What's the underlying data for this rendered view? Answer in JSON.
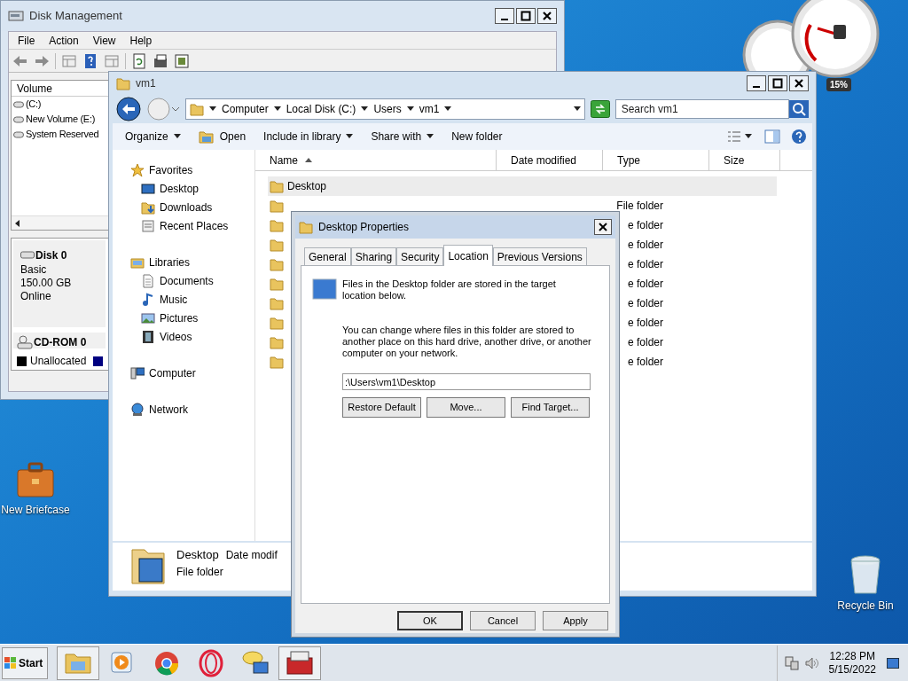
{
  "disk_management": {
    "title": "Disk Management",
    "menu": [
      "File",
      "Action",
      "View",
      "Help"
    ],
    "volume_header": "Volume",
    "volumes": [
      "(C:)",
      "New Volume (E:)",
      "System Reserved"
    ],
    "disks": [
      {
        "kind": "hdd",
        "name": "Disk 0",
        "lines": [
          "Basic",
          "150.00 GB",
          "Online"
        ]
      },
      {
        "kind": "cdrom",
        "name": "CD-ROM 0"
      }
    ],
    "legend": [
      {
        "label": "Unallocated",
        "color": "#000000"
      },
      {
        "color": "#000080"
      }
    ]
  },
  "gadget": {
    "reading": "15%"
  },
  "explorer": {
    "title": "vm1",
    "breadcrumb": [
      "Computer",
      "Local Disk (C:)",
      "Users",
      "vm1"
    ],
    "search": {
      "placeholder": "Search vm1"
    },
    "toolbar": [
      {
        "label": "Organize",
        "kind": "menu"
      },
      {
        "label": "Open",
        "kind": "open"
      },
      {
        "label": "Include in library",
        "kind": "menu"
      },
      {
        "label": "Share with",
        "kind": "menu"
      },
      {
        "label": "New folder",
        "kind": "plain"
      }
    ],
    "nav": [
      {
        "label": "Favorites",
        "kind": "star",
        "children": [
          {
            "label": "Desktop",
            "kind": "desktop"
          },
          {
            "label": "Downloads",
            "kind": "downloads"
          },
          {
            "label": "Recent Places",
            "kind": "recent"
          }
        ]
      },
      {
        "label": "Libraries",
        "kind": "library",
        "children": [
          {
            "label": "Documents",
            "kind": "document"
          },
          {
            "label": "Music",
            "kind": "music"
          },
          {
            "label": "Pictures",
            "kind": "picture"
          },
          {
            "label": "Videos",
            "kind": "video"
          }
        ]
      },
      {
        "label": "Computer",
        "kind": "computer"
      },
      {
        "label": "Network",
        "kind": "network"
      }
    ],
    "columns": [
      {
        "label": "Name",
        "sorted": true
      },
      {
        "label": "Date modified",
        "sorted": false
      },
      {
        "label": "Type",
        "sorted": false
      },
      {
        "label": "Size",
        "sorted": false
      }
    ],
    "rows": [
      {
        "name": "Desktop",
        "selected": true
      },
      {
        "type": "File folder",
        "selected": false
      },
      {
        "type": "e folder",
        "selected": false
      },
      {
        "type": "e folder",
        "selected": false
      },
      {
        "type": "e folder",
        "selected": false
      },
      {
        "type": "e folder",
        "selected": false
      },
      {
        "type": "e folder",
        "selected": false
      },
      {
        "type": "e folder",
        "selected": false
      },
      {
        "type": "e folder",
        "selected": false
      },
      {
        "type": "e folder",
        "selected": false
      }
    ],
    "details": {
      "name": "Desktop",
      "date_label": "Date modif",
      "type": "File folder"
    }
  },
  "dialog": {
    "title": "Desktop Properties",
    "tabs": [
      {
        "label": "General",
        "selected": false
      },
      {
        "label": "Sharing",
        "selected": false
      },
      {
        "label": "Security",
        "selected": false
      },
      {
        "label": "Location",
        "selected": true
      },
      {
        "label": "Previous Versions",
        "selected": false
      }
    ],
    "info": "Files in the Desktop folder are stored in the target location below.",
    "help": "You can change where files in this folder are stored to another place on this hard drive, another drive, or another computer on your network.",
    "path": ":\\Users\\vm1\\Desktop",
    "actions": [
      "Restore Default",
      "Move...",
      "Find Target..."
    ],
    "footer": [
      {
        "label": "OK",
        "default": true
      },
      {
        "label": "Cancel",
        "default": false
      },
      {
        "label": "Apply",
        "default": false
      }
    ]
  },
  "desktop_icons": [
    {
      "label": "New Briefcase",
      "kind": "briefcase"
    },
    {
      "label": "Recycle Bin",
      "kind": "bin"
    }
  ],
  "taskbar": {
    "start": "Start",
    "apps": [
      {
        "kind": "explorer"
      },
      {
        "kind": "media"
      },
      {
        "kind": "chrome"
      },
      {
        "kind": "opera"
      },
      {
        "kind": "chat"
      },
      {
        "kind": "toolbox"
      }
    ],
    "time": "12:28 PM",
    "date": "5/15/2022"
  }
}
